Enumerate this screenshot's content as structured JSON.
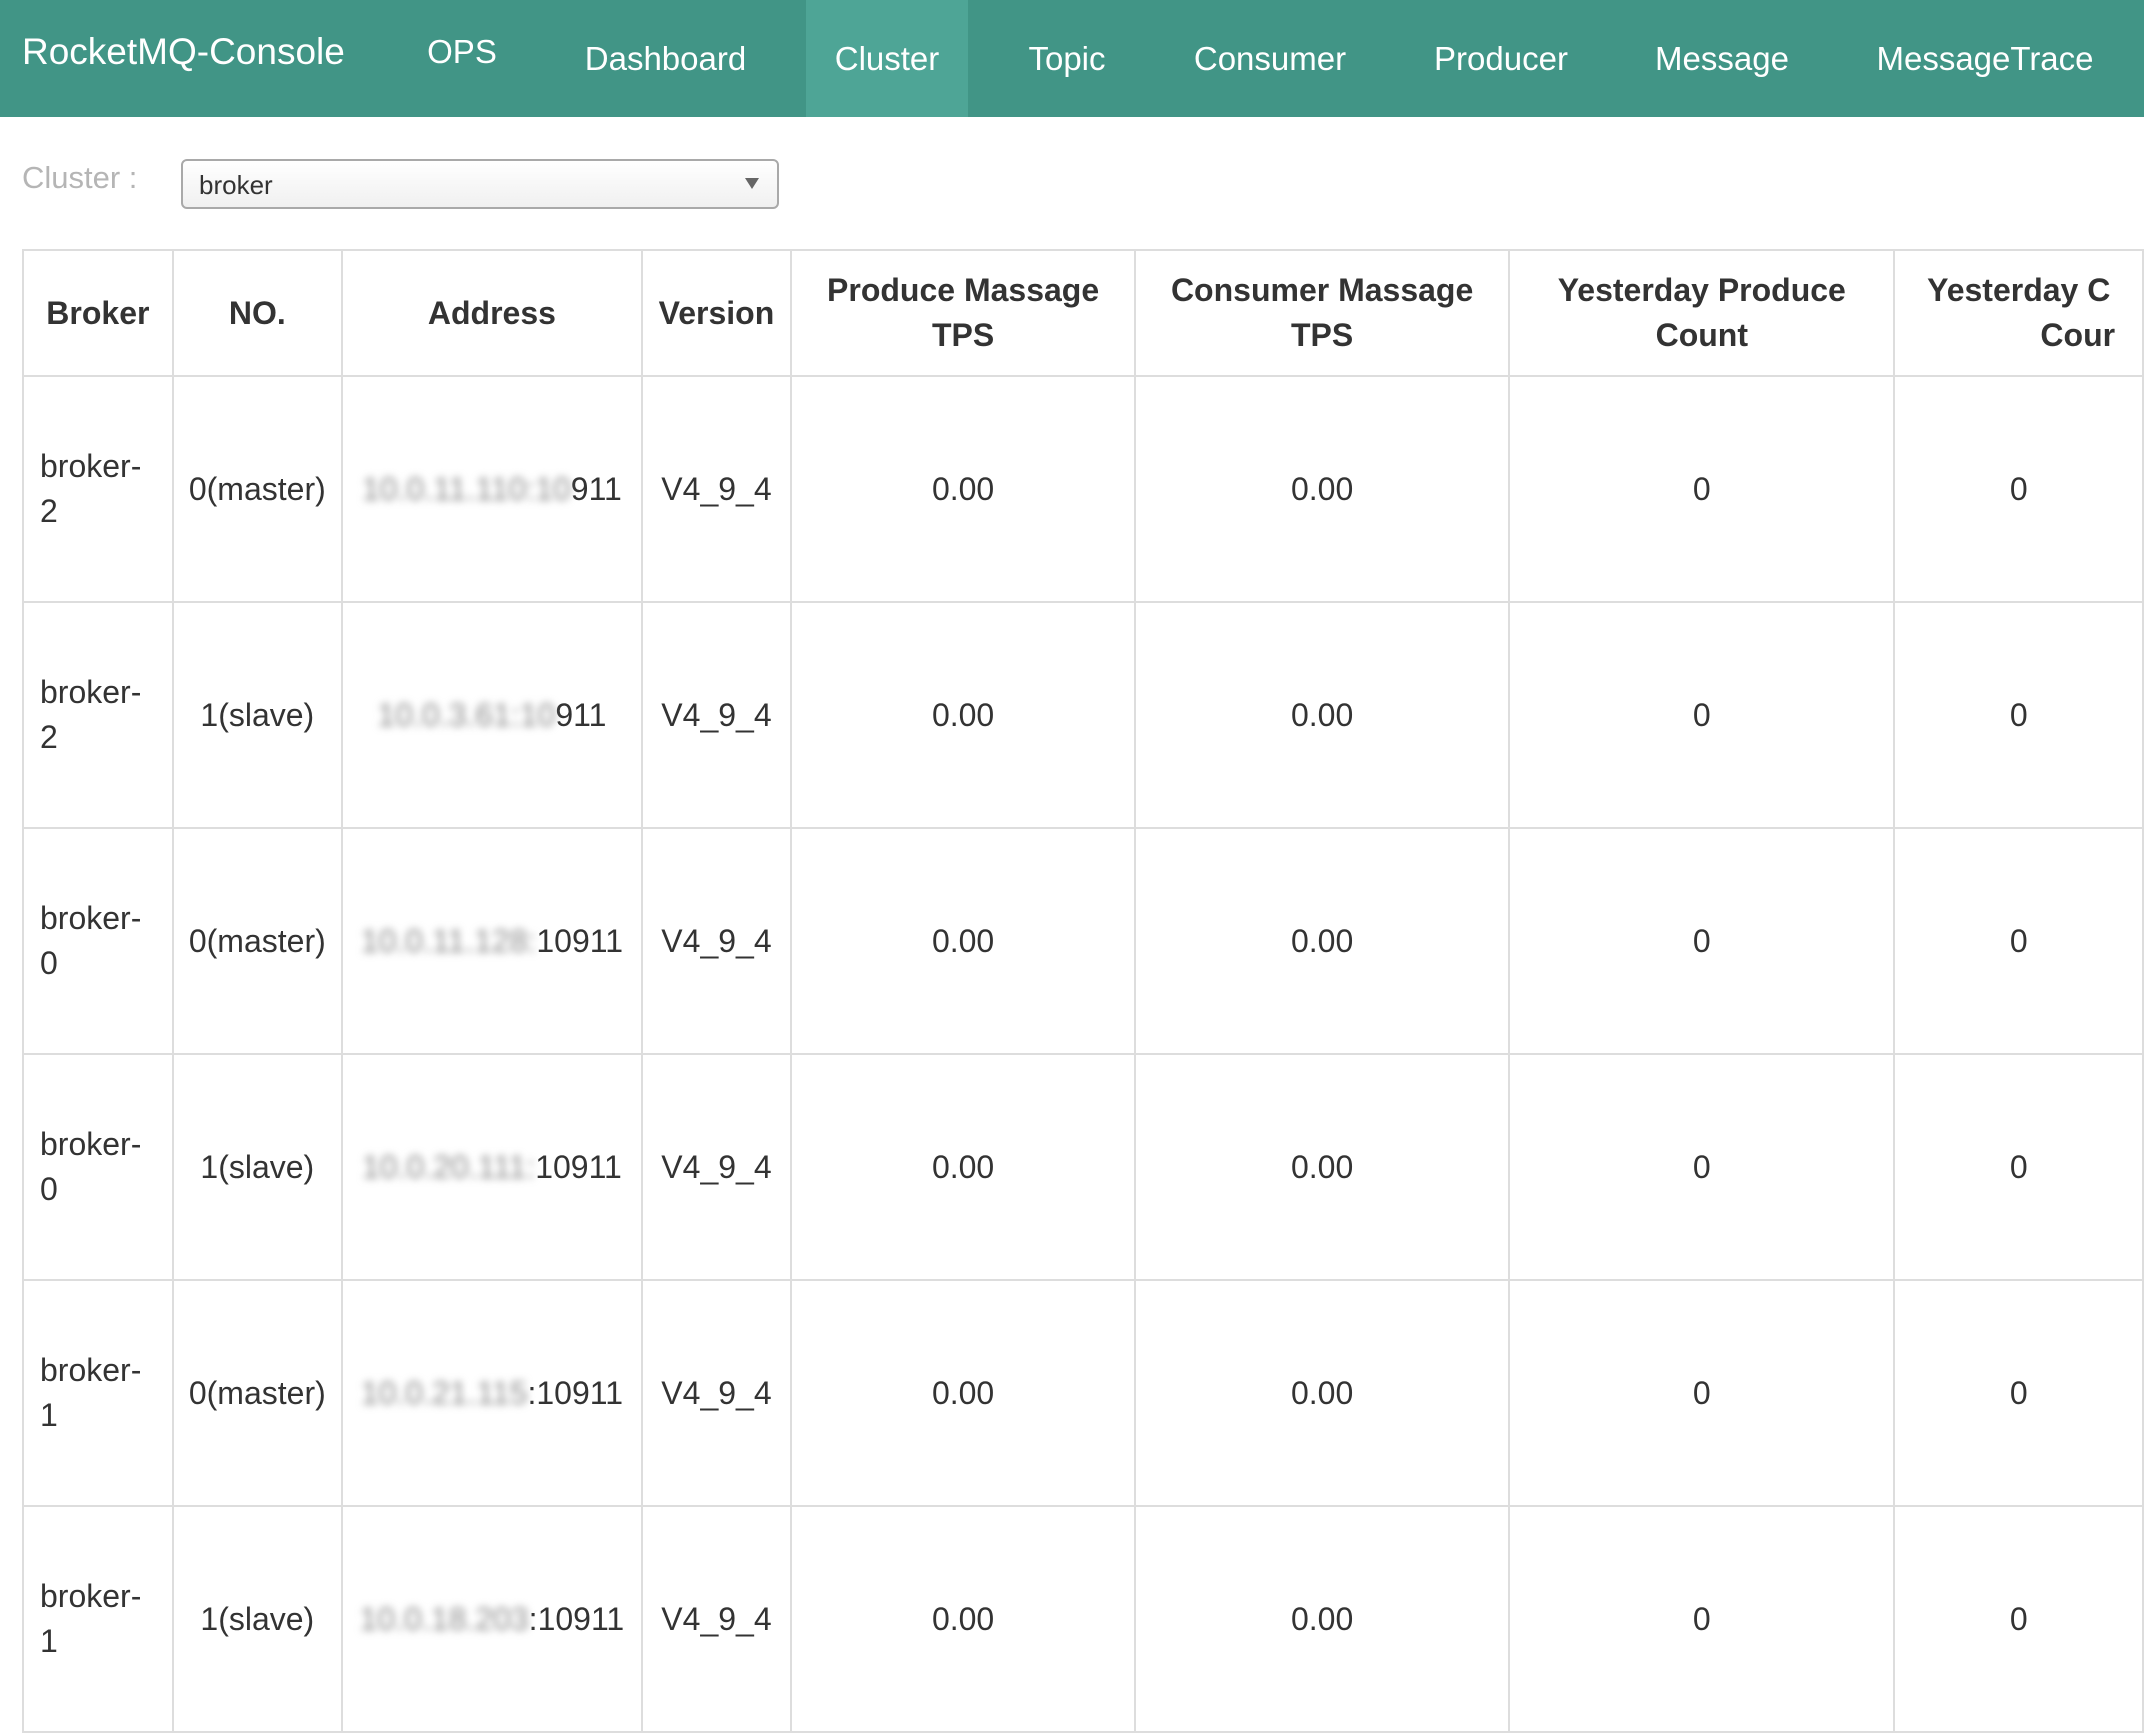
{
  "navbar": {
    "brand": "RocketMQ-Console",
    "items": [
      {
        "label": "OPS"
      },
      {
        "label": "Dashboard"
      },
      {
        "label": "Cluster"
      },
      {
        "label": "Topic"
      },
      {
        "label": "Consumer"
      },
      {
        "label": "Producer"
      },
      {
        "label": "Message"
      },
      {
        "label": "MessageTrace"
      }
    ],
    "active": "Cluster"
  },
  "filter": {
    "label": "Cluster :",
    "selected": "broker"
  },
  "table": {
    "headers": {
      "broker": "Broker",
      "no": "NO.",
      "address": "Address",
      "version": "Version",
      "produce_tps_line1": "Produce Massage",
      "produce_tps_line2": "TPS",
      "consumer_tps_line1": "Consumer Massage",
      "consumer_tps_line2": "TPS",
      "yesterday_produce_line1": "Yesterday Produce",
      "yesterday_produce_line2": "Count",
      "yesterday_consume_line1": "Yesterday C",
      "yesterday_consume_line2": "Cour"
    },
    "rows": [
      {
        "broker_line1": "broker-",
        "broker_line2": "2",
        "no": "0(master)",
        "address_masked": "10.0.11.110:10",
        "address_visible": "911",
        "version": "V4_9_4",
        "produce_tps": "0.00",
        "consumer_tps": "0.00",
        "yesterday_produce": "0",
        "yesterday_consume": "0"
      },
      {
        "broker_line1": "broker-",
        "broker_line2": "2",
        "no": "1(slave)",
        "address_masked": "10.0.3.61:10",
        "address_visible": "911",
        "version": "V4_9_4",
        "produce_tps": "0.00",
        "consumer_tps": "0.00",
        "yesterday_produce": "0",
        "yesterday_consume": "0"
      },
      {
        "broker_line1": "broker-",
        "broker_line2": "0",
        "no": "0(master)",
        "address_masked": "10.0.11.128:",
        "address_visible": "10911",
        "version": "V4_9_4",
        "produce_tps": "0.00",
        "consumer_tps": "0.00",
        "yesterday_produce": "0",
        "yesterday_consume": "0"
      },
      {
        "broker_line1": "broker-",
        "broker_line2": "0",
        "no": "1(slave)",
        "address_masked": "10.0.20.111:",
        "address_visible": "10911",
        "version": "V4_9_4",
        "produce_tps": "0.00",
        "consumer_tps": "0.00",
        "yesterday_produce": "0",
        "yesterday_consume": "0"
      },
      {
        "broker_line1": "broker-",
        "broker_line2": "1",
        "no": "0(master)",
        "address_masked": "10.0.21.115",
        "address_visible": ":10911",
        "version": "V4_9_4",
        "produce_tps": "0.00",
        "consumer_tps": "0.00",
        "yesterday_produce": "0",
        "yesterday_consume": "0"
      },
      {
        "broker_line1": "broker-",
        "broker_line2": "1",
        "no": "1(slave)",
        "address_masked": "10.0.18.203",
        "address_visible": ":10911",
        "version": "V4_9_4",
        "produce_tps": "0.00",
        "consumer_tps": "0.00",
        "yesterday_produce": "0",
        "yesterday_consume": "0"
      }
    ]
  },
  "colors": {
    "navbar_bg": "#419586",
    "navbar_active_bg": "#4ea596",
    "table_border": "#dddddd"
  }
}
